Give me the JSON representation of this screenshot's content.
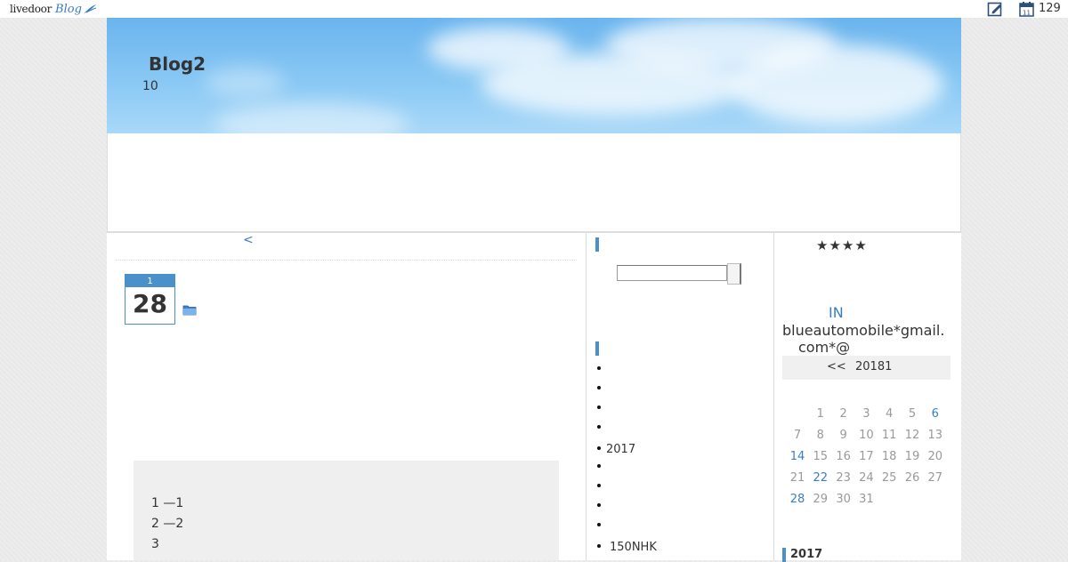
{
  "topbar": {
    "logo_text": "livedoor",
    "logo_blog": "Blog",
    "edit_icon": "edit-pencil-icon",
    "calendar_icon": "calendar-icon",
    "calendar_icon_number": "11",
    "count": "129"
  },
  "header": {
    "title": "Blog2",
    "description": "10"
  },
  "main": {
    "prev_link": "<",
    "date": {
      "month": "1",
      "day": "28"
    },
    "category_icon": "folder-icon",
    "toc": [
      "1 —1",
      "2 —2",
      "3"
    ]
  },
  "sidebar_mid": {
    "list_items": [
      "",
      "",
      "",
      "",
      "2017",
      "",
      "",
      "",
      "",
      "150NHK"
    ]
  },
  "sidebar_right": {
    "stars": "★★★★",
    "in_link": "IN",
    "email_line1": "blueautomobile*gmail.",
    "email_line2": "com*@",
    "calendar": {
      "prev": "<<",
      "title": "20181",
      "weeks": [
        [
          "",
          "1",
          "2",
          "3",
          "4",
          "5",
          "6"
        ],
        [
          "7",
          "8",
          "9",
          "10",
          "11",
          "12",
          "13"
        ],
        [
          "14",
          "15",
          "16",
          "17",
          "18",
          "19",
          "20"
        ],
        [
          "21",
          "22",
          "23",
          "24",
          "25",
          "26",
          "27"
        ],
        [
          "28",
          "29",
          "30",
          "31",
          "",
          "",
          ""
        ]
      ],
      "linked_days": [
        "6",
        "14",
        "22",
        "28"
      ]
    },
    "archive_heading": "2017"
  },
  "colors": {
    "accent": "#4a90c9",
    "link": "#3a7dc4",
    "text": "#333333"
  }
}
